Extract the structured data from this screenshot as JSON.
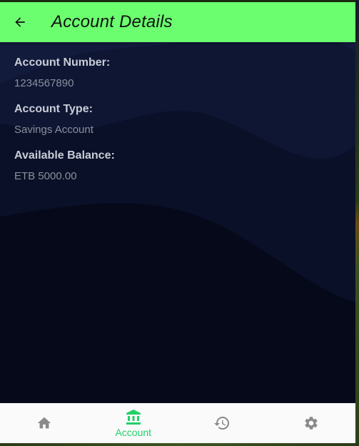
{
  "appbar": {
    "title": "Account Details",
    "back_icon": "arrow-left-icon",
    "color": "#6bff6f"
  },
  "fields": [
    {
      "label": "Account Number:",
      "value": "1234567890"
    },
    {
      "label": "Account Type:",
      "value": "Savings Account"
    },
    {
      "label": "Available Balance:",
      "value": "ETB 5000.00"
    }
  ],
  "bottom_nav": {
    "active_color": "#22d06a",
    "inactive_color": "#8a8a8a",
    "items": [
      {
        "icon": "home-icon",
        "label": "",
        "active": false
      },
      {
        "icon": "bank-icon",
        "label": "Account",
        "active": true
      },
      {
        "icon": "history-icon",
        "label": "",
        "active": false
      },
      {
        "icon": "gear-icon",
        "label": "",
        "active": false
      }
    ]
  }
}
